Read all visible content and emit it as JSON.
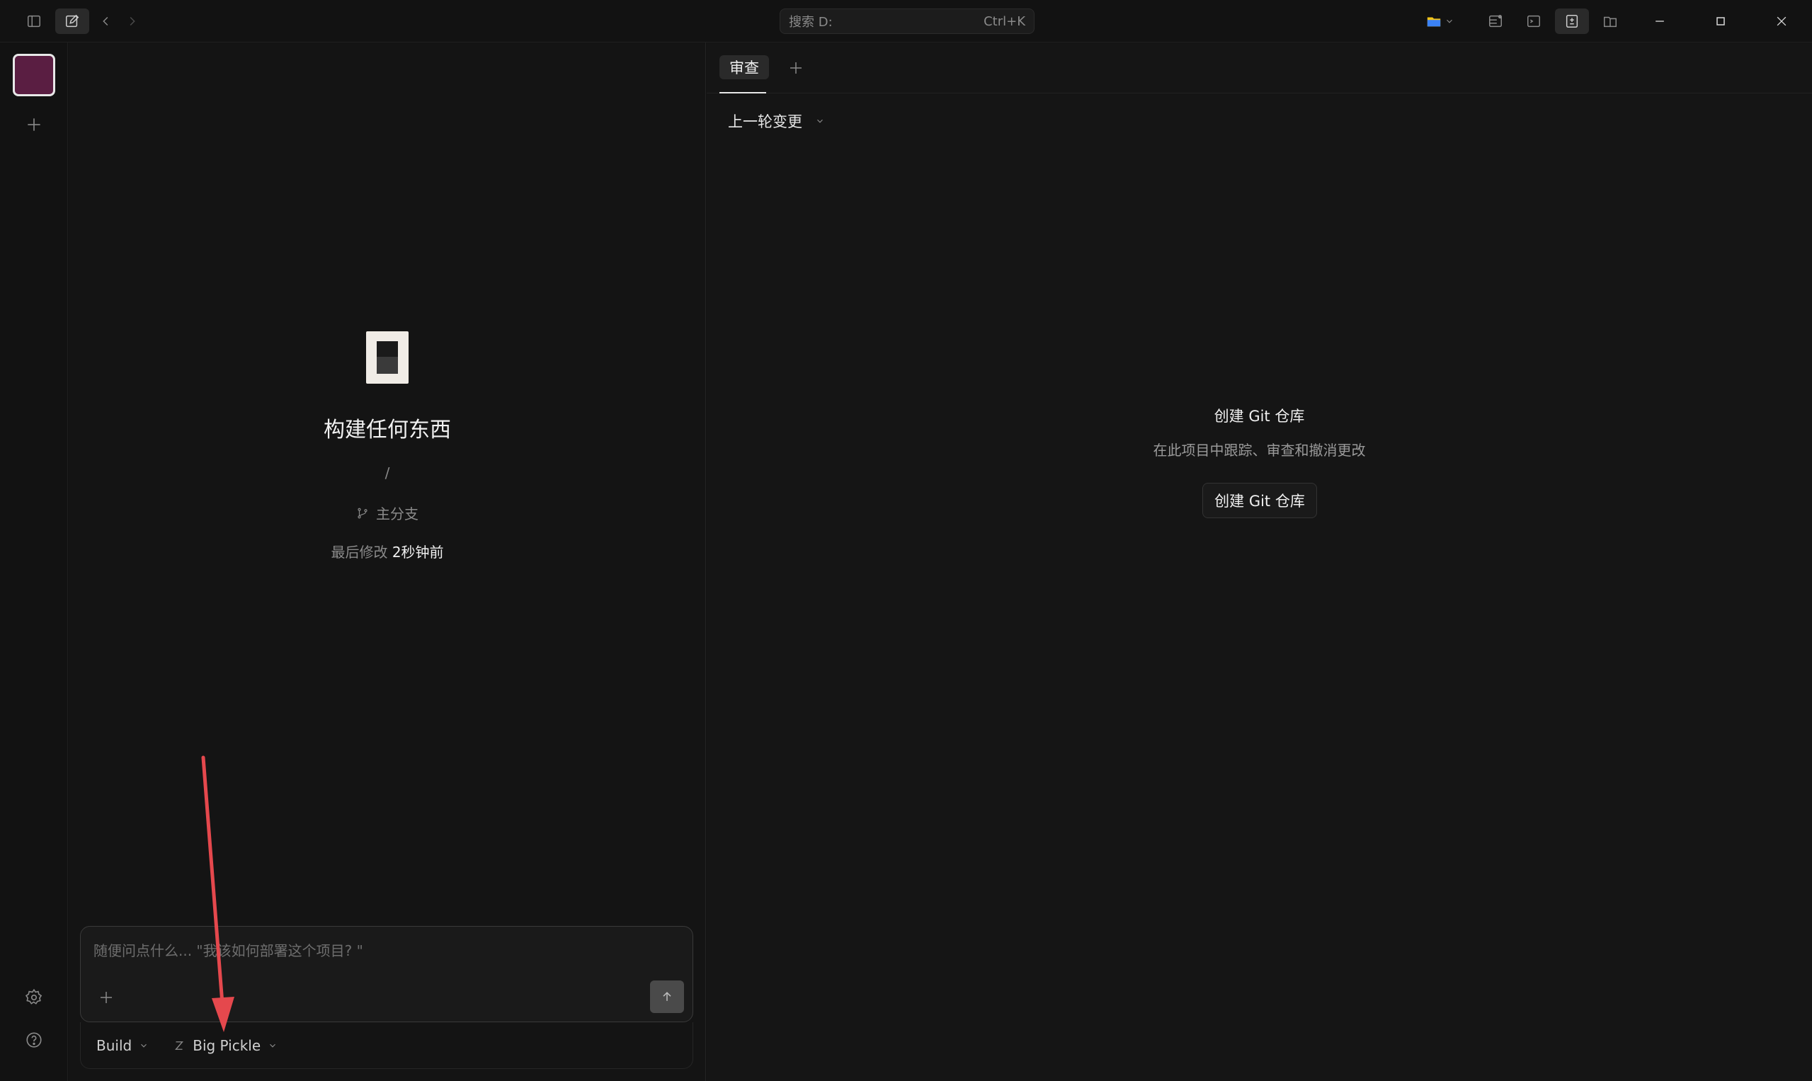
{
  "titlebar": {
    "search_label": "搜索 D:",
    "search_shortcut": "Ctrl+K"
  },
  "center": {
    "hero_title": "构建任何东西",
    "path": "/",
    "branch": "主分支",
    "modified_label": "最后修改",
    "modified_value": "2秒钟前"
  },
  "composer": {
    "placeholder": "随便问点什么... \"我该如何部署这个项目? \"",
    "mode": "Build",
    "model": "Big Pickle"
  },
  "right": {
    "tab_label": "审查",
    "changes_label": "上一轮变更",
    "git_title": "创建 Git 仓库",
    "git_subtitle": "在此项目中跟踪、审查和撤消更改",
    "git_button": "创建 Git 仓库"
  },
  "colors": {
    "project_accent": "#5a1e42",
    "annotation_arrow": "#e5484d",
    "folder_icon": "#f5c518"
  }
}
